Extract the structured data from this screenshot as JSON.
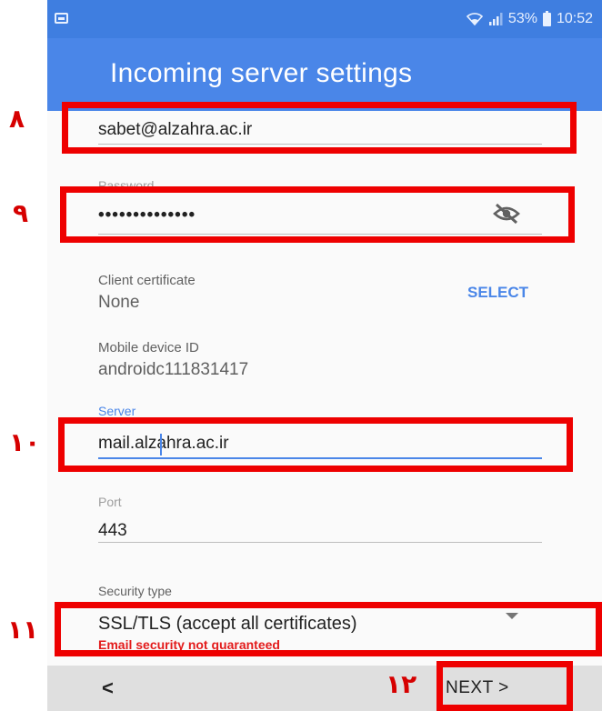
{
  "status_bar": {
    "battery_text": "53%",
    "time": "10:52"
  },
  "app_bar": {
    "title": "Incoming server settings"
  },
  "fields": {
    "email": {
      "value": "sabet@alzahra.ac.ir"
    },
    "password": {
      "label": "Password",
      "value": "••••••••••••••"
    },
    "client_certificate": {
      "label": "Client certificate",
      "value": "None",
      "action": "SELECT"
    },
    "mobile_device_id": {
      "label": "Mobile device ID",
      "value": "androidc111831417"
    },
    "server": {
      "label": "Server",
      "value": "mail.alzahra.ac.ir"
    },
    "port": {
      "label": "Port",
      "value": "443"
    },
    "security_type": {
      "label": "Security type",
      "value": "SSL/TLS (accept all certificates)",
      "warning": "Email security not guaranteed"
    }
  },
  "bottom_bar": {
    "back_label": "<",
    "next_label": "NEXT >"
  },
  "annotations": [
    "٨",
    "٩",
    "١٠",
    "١١",
    "١٢"
  ],
  "colors": {
    "accent": "#4a86e8",
    "status_bar": "#3f7ee0",
    "annotation": "#ee0000",
    "warning": "#e31b1b"
  },
  "icons": [
    "wifi-icon",
    "signal-icon",
    "battery-icon",
    "visibility-off-icon",
    "dropdown-arrow-icon"
  ]
}
